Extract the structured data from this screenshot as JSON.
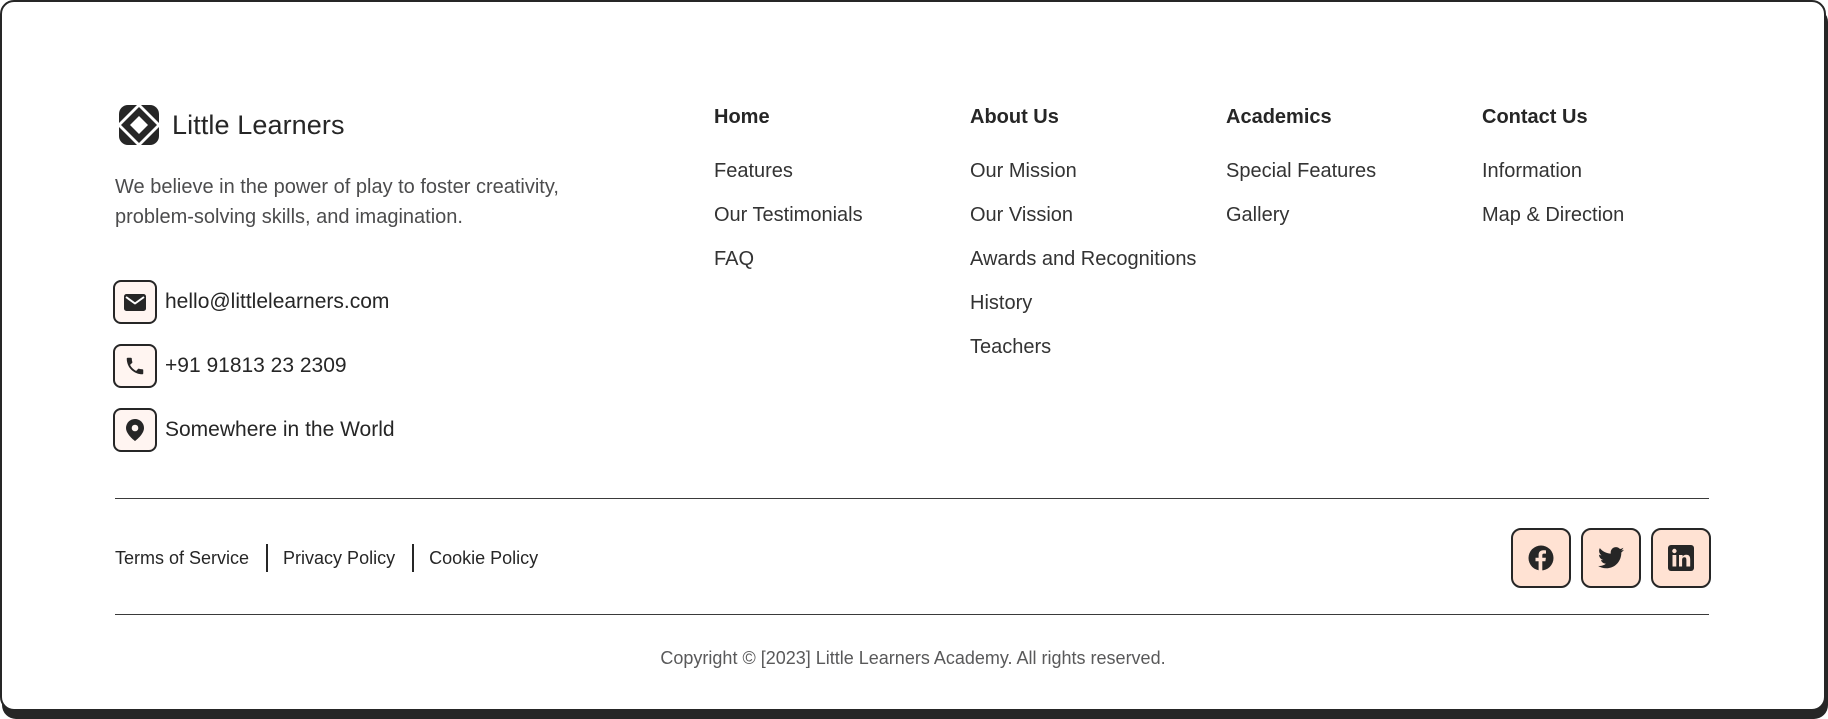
{
  "brand": {
    "name": "Little Learners",
    "tagline": "We believe in the power of play to foster creativity, problem-solving skills, and imagination."
  },
  "contacts": [
    {
      "icon": "mail-icon",
      "text": "hello@littlelearners.com"
    },
    {
      "icon": "phone-icon",
      "text": "+91 91813 23 2309"
    },
    {
      "icon": "location-pin-icon",
      "text": "Somewhere in the World"
    }
  ],
  "nav": [
    {
      "heading": "Home",
      "links": [
        "Features",
        "Our Testimonials",
        "FAQ"
      ]
    },
    {
      "heading": "About Us",
      "links": [
        "Our Mission",
        "Our Vission",
        "Awards and Recognitions",
        "History",
        "Teachers"
      ]
    },
    {
      "heading": "Academics",
      "links": [
        "Special Features",
        "Gallery"
      ]
    },
    {
      "heading": "Contact Us",
      "links": [
        "Information",
        "Map & Direction"
      ]
    }
  ],
  "policies": [
    "Terms of Service",
    "Privacy Policy",
    "Cookie Policy"
  ],
  "socials": [
    {
      "icon": "facebook-icon"
    },
    {
      "icon": "twitter-icon"
    },
    {
      "icon": "linkedin-icon"
    }
  ],
  "copyright": "Copyright © [2023] Little Learners Academy. All rights reserved.",
  "colors": {
    "ink": "#262626",
    "contact_icon_bg": "#fff5f1",
    "social_bg": "#ffe2d3"
  }
}
